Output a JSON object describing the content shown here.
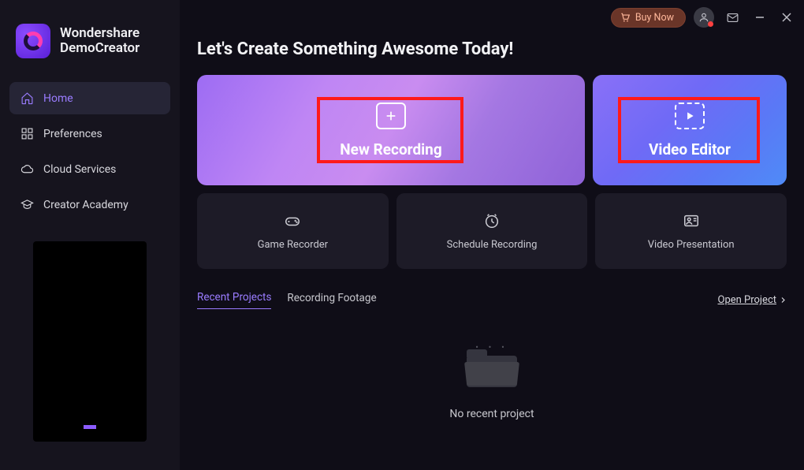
{
  "topbar": {
    "buy_now": "Buy Now"
  },
  "app": {
    "brand_line1": "Wondershare",
    "brand_line2": "DemoCreator"
  },
  "nav": {
    "home": "Home",
    "preferences": "Preferences",
    "cloud": "Cloud Services",
    "academy": "Creator Academy"
  },
  "main": {
    "heading": "Let's Create Something Awesome Today!",
    "hero": {
      "new_recording": "New Recording",
      "video_editor": "Video Editor"
    },
    "tools": {
      "game_recorder": "Game Recorder",
      "schedule_recording": "Schedule Recording",
      "video_presentation": "Video Presentation"
    },
    "tabs": {
      "recent_projects": "Recent Projects",
      "recording_footage": "Recording Footage",
      "open_project": "Open Project"
    },
    "empty": "No recent project"
  }
}
